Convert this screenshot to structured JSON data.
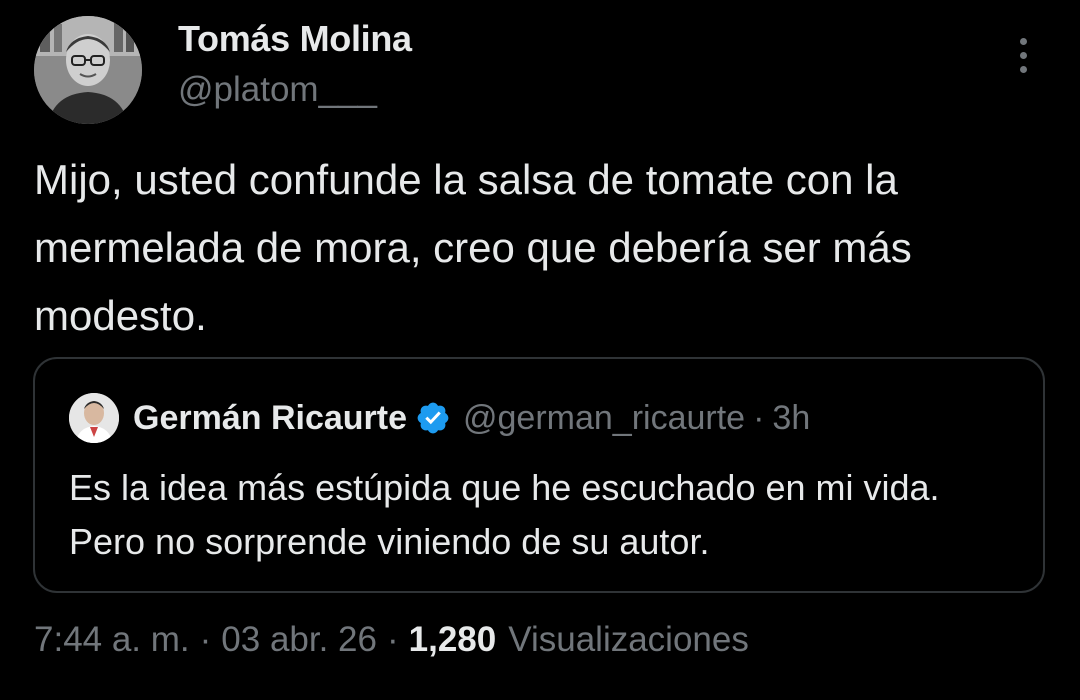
{
  "author": {
    "name": "Tomás Molina",
    "handle": "@platom___",
    "avatar_icon": "profile-photo"
  },
  "tweet": {
    "text": "Mijo, usted confunde la salsa de tomate con la mermelada de mora, creo que debería ser más modesto."
  },
  "quoted_tweet": {
    "name": "Germán Ricaurte",
    "verified": true,
    "verified_color": "#1d9bf0",
    "handle": "@german_ricaurte",
    "separator": "·",
    "time": "3h",
    "text": "Es la idea más estúpida que he escuchado en mi vida. Pero no sorprende viniendo de su autor."
  },
  "meta": {
    "time": "7:44 a. m.",
    "separator": "·",
    "date": "03 abr. 26",
    "views_count": "1,280",
    "views_label": "Visualizaciones"
  },
  "colors": {
    "background": "#000000",
    "text_primary": "#e7e9ea",
    "text_secondary": "#71767b",
    "border": "#2f3336"
  }
}
